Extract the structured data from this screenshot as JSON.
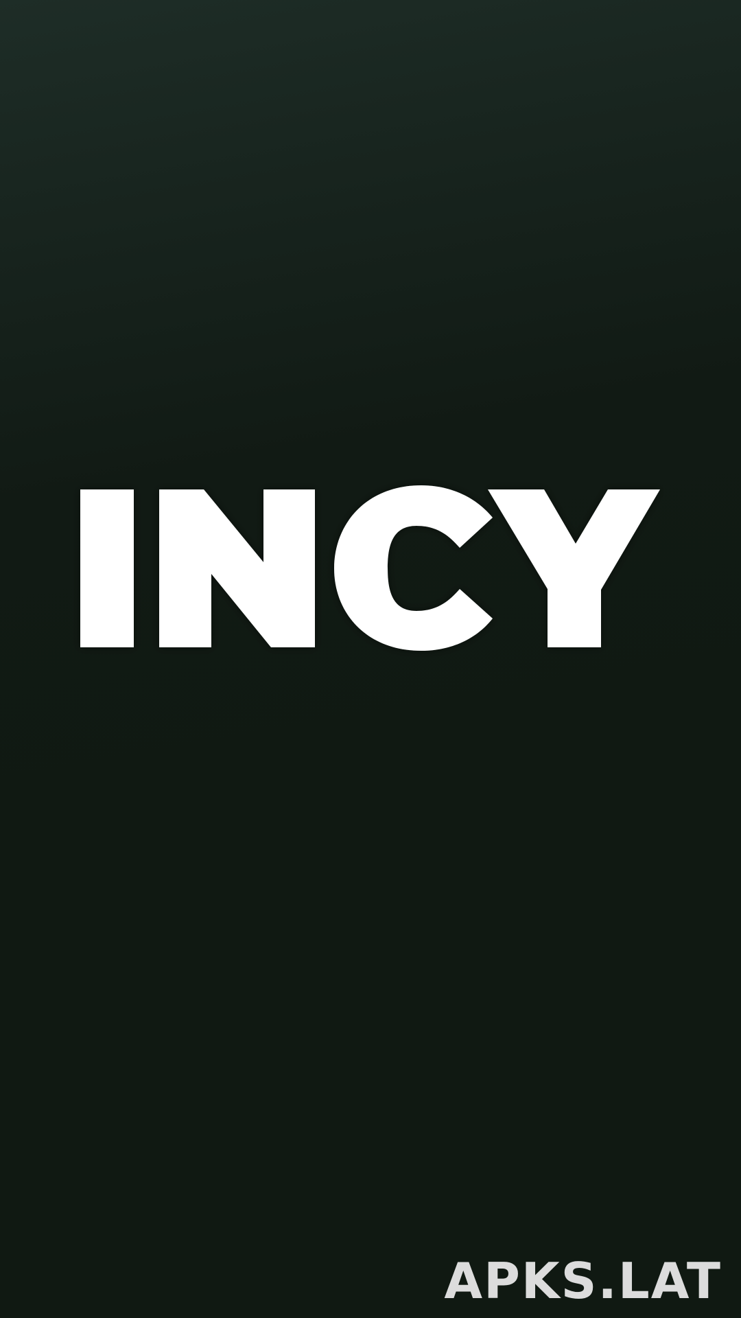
{
  "app": {
    "logo_text": "INCY",
    "logo_color": "#ffffff",
    "background_colors": [
      "#1e2d27",
      "#101912"
    ]
  },
  "watermark": {
    "text": "APKS.LAT",
    "color": "#dcdcdc"
  }
}
